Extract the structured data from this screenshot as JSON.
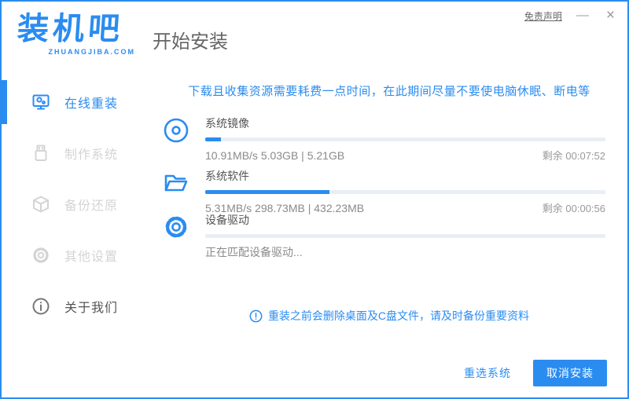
{
  "window": {
    "disclaimer_label": "免责声明",
    "minimize_glyph": "—",
    "close_glyph": "×"
  },
  "logo": {
    "title": "装机吧",
    "subtitle": "ZHUANGJIBA.COM"
  },
  "header": {
    "title": "开始安装"
  },
  "sidebar": {
    "items": [
      {
        "label": "在线重装",
        "icon": "monitor-icon",
        "state": "active"
      },
      {
        "label": "制作系统",
        "icon": "usb-icon",
        "state": "disabled"
      },
      {
        "label": "备份还原",
        "icon": "box-icon",
        "state": "disabled"
      },
      {
        "label": "其他设置",
        "icon": "gear-icon",
        "state": "disabled"
      },
      {
        "label": "关于我们",
        "icon": "info-icon",
        "state": "normal"
      }
    ]
  },
  "main": {
    "notice": "下载且收集资源需要耗费一点时间，在此期间尽量不要使电脑休眠、断电等",
    "tasks": [
      {
        "icon": "disc-icon",
        "title": "系统镜像",
        "detail": "10.91MB/s 5.03GB | 5.21GB",
        "remaining": "剩余 00:07:52",
        "progress_percent": 4
      },
      {
        "icon": "folder-icon",
        "title": "系统软件",
        "detail": "5.31MB/s 298.73MB | 432.23MB",
        "remaining": "剩余 00:00:56",
        "progress_percent": 31
      },
      {
        "icon": "gear-icon",
        "title": "设备驱动",
        "detail": "正在匹配设备驱动...",
        "remaining": "",
        "progress_percent": 0
      }
    ],
    "warning": "重装之前会删除桌面及C盘文件，请及时备份重要资料"
  },
  "footer": {
    "reselect_label": "重选系统",
    "cancel_label": "取消安装"
  },
  "colors": {
    "primary_blue": "#2b8cf0",
    "track_gray": "#e9eef6",
    "text_gray": "#8a8a8a"
  }
}
